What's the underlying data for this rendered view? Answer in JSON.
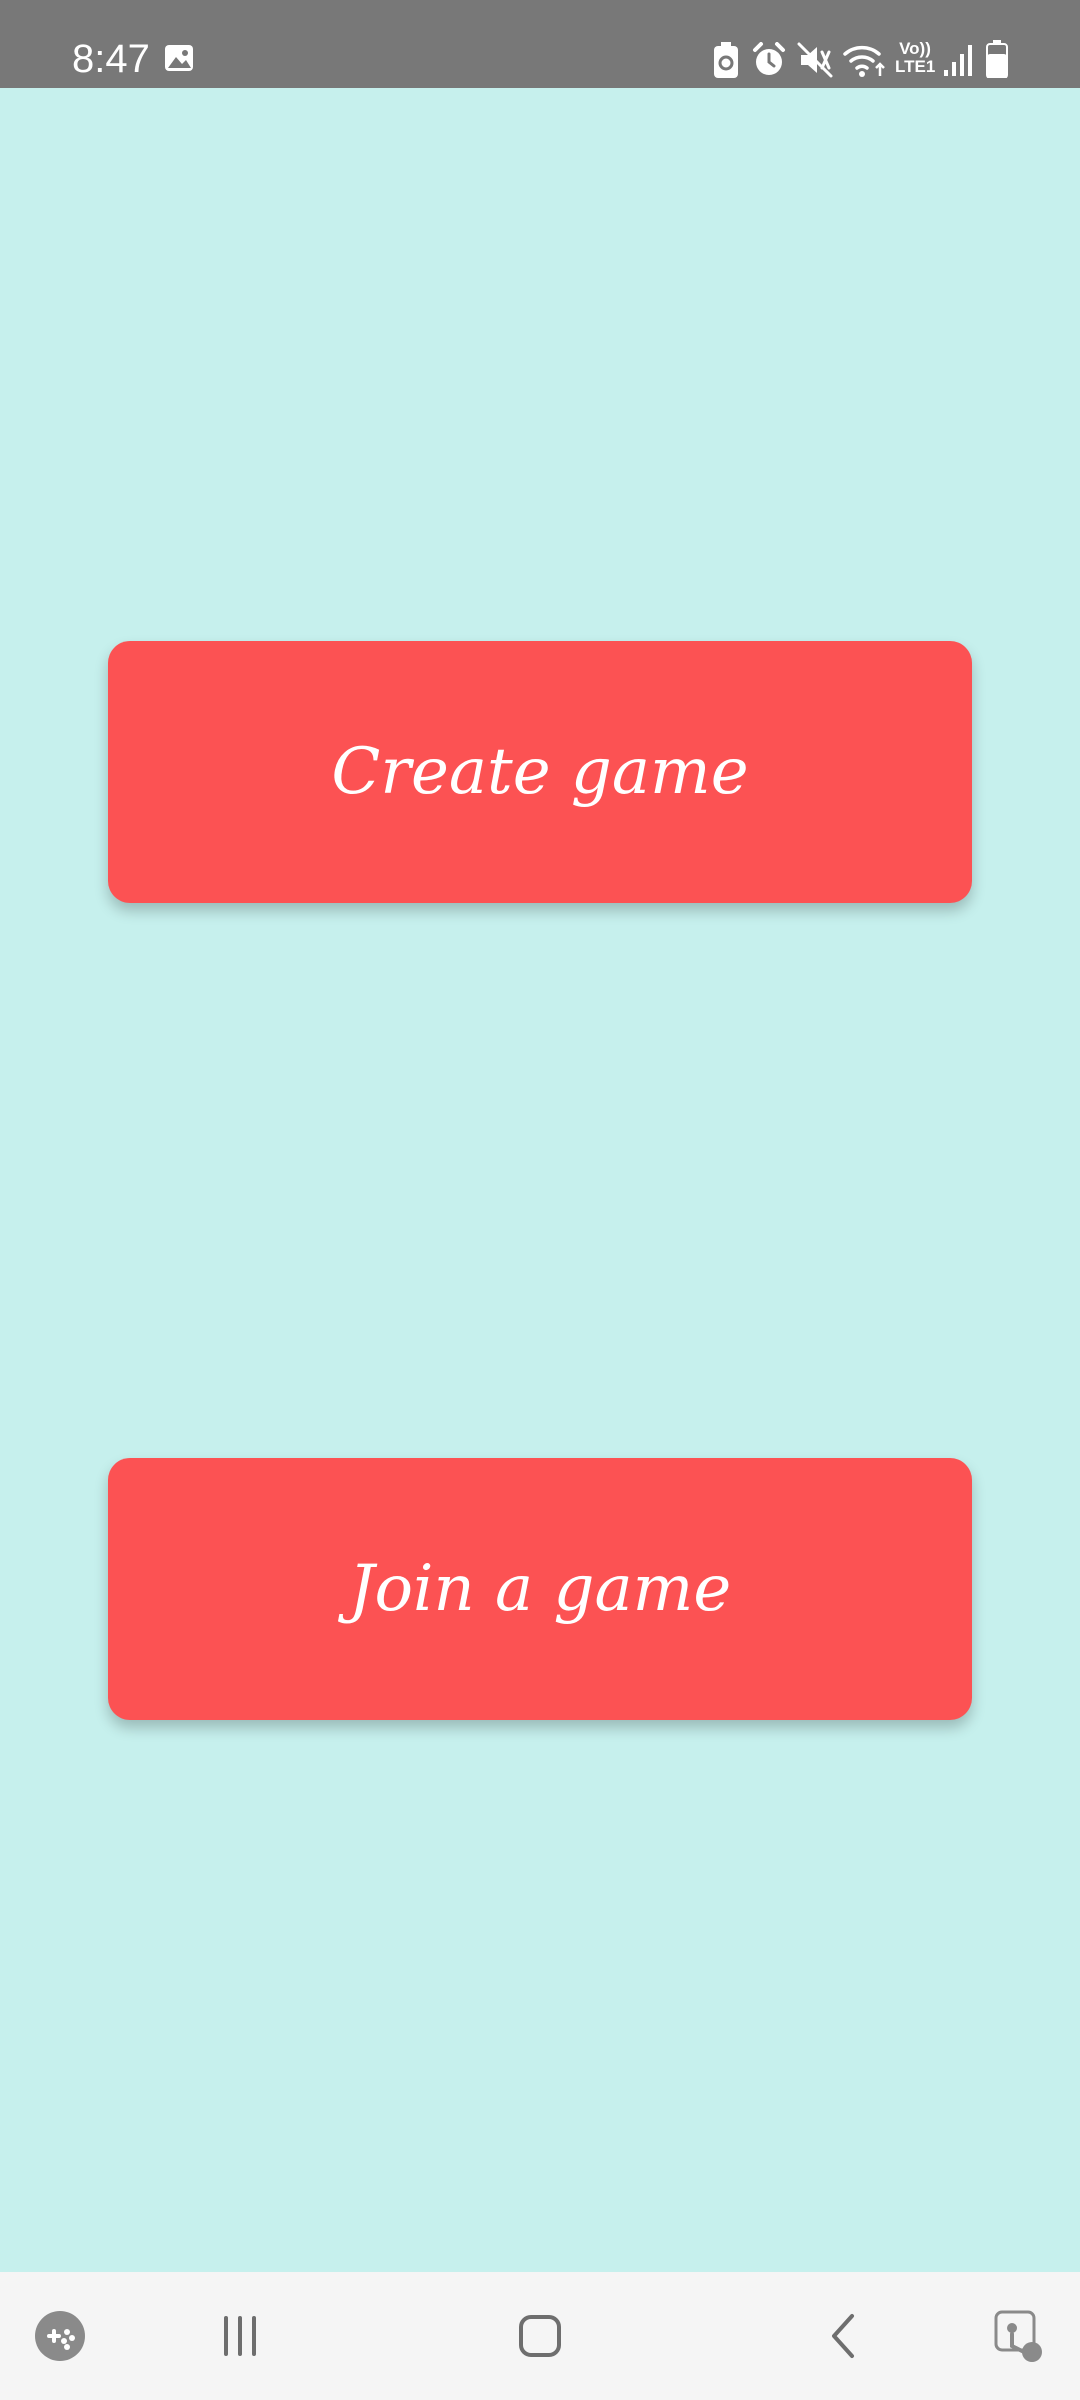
{
  "status_bar": {
    "time": "8:47",
    "icons": [
      "gallery-icon",
      "battery-saver-icon",
      "alarm-icon",
      "mute-icon",
      "wifi-icon",
      "volte-icon",
      "signal-icon",
      "battery-icon"
    ],
    "volte_top": "Vo))",
    "volte_bottom": "LTE1"
  },
  "main": {
    "create_button_label": "Create game",
    "join_button_label": "Join a game"
  },
  "nav_bar": {
    "items": [
      "game-launcher-icon",
      "recent-apps-icon",
      "home-icon",
      "back-icon",
      "accessibility-icon"
    ]
  },
  "colors": {
    "background": "#c6f0ed",
    "button": "#fc5253",
    "status_bar": "#787878",
    "nav_bar": "#f5f5f5"
  }
}
